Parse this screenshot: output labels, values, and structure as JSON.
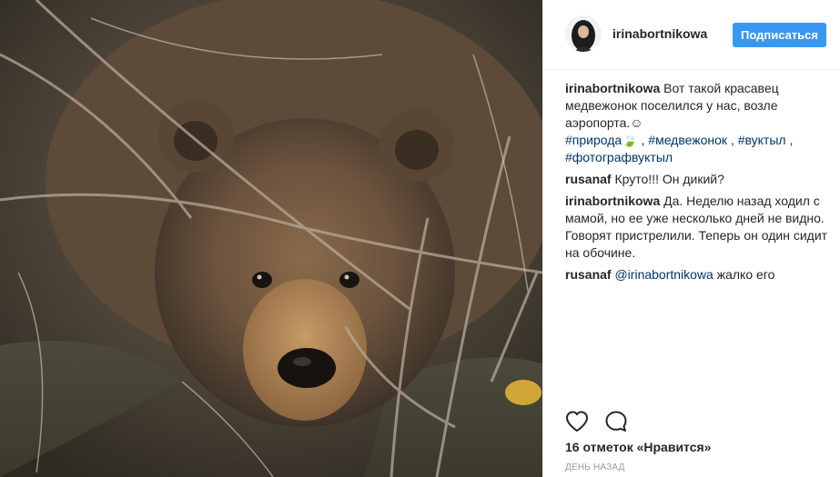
{
  "photo": {
    "alt_icon": "bear-photo"
  },
  "header": {
    "username": "irinabortnikowa",
    "follow_label": "Подписаться"
  },
  "caption": {
    "author": "irinabortnikowa",
    "text": "Вот такой красавец медвежонок поселился у нас, возле аэропорта.☺",
    "tags": [
      {
        "label": "#природа🍃",
        "sep": " , "
      },
      {
        "label": "#медвежонок",
        "sep": " , "
      },
      {
        "label": "#вуктыл",
        "sep": " , "
      },
      {
        "label": "#фотографвуктыл",
        "sep": ""
      }
    ]
  },
  "comments": [
    {
      "author": "rusanaf",
      "text": "Круто!!! Он дикий?"
    },
    {
      "author": "irinabortnikowa",
      "text": "Да. Неделю назад ходил с мамой, но ее уже несколько дней не видно. Говорят пристрелили. Теперь он один сидит на обочине."
    },
    {
      "author": "rusanaf",
      "mention": "@irinabortnikowa",
      "text": " жалко его"
    }
  ],
  "actions": {
    "like_icon": "heart-icon",
    "comment_icon": "comment-icon"
  },
  "likes": "16 отметок «Нравится»",
  "timestamp": "день назад"
}
